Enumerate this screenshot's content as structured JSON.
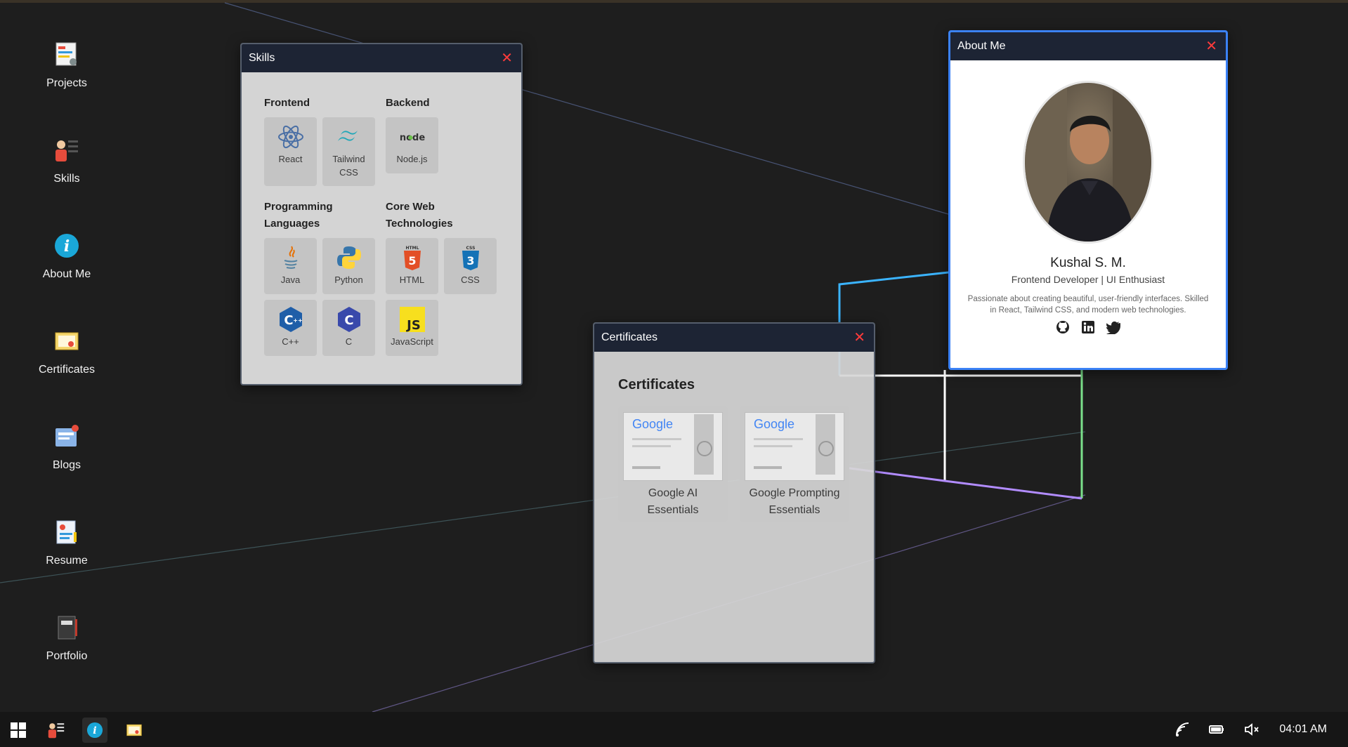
{
  "desktop": {
    "icons": [
      {
        "label": "Projects",
        "icon": "projects-icon"
      },
      {
        "label": "Skills",
        "icon": "skills-icon"
      },
      {
        "label": "About Me",
        "icon": "info-icon"
      },
      {
        "label": "Certificates",
        "icon": "certificate-icon"
      },
      {
        "label": "Blogs",
        "icon": "blog-icon"
      },
      {
        "label": "Resume",
        "icon": "resume-icon"
      },
      {
        "label": "Portfolio",
        "icon": "portfolio-icon"
      }
    ]
  },
  "skills_window": {
    "title": "Skills",
    "close": "✕",
    "groups": {
      "frontend": {
        "title": "Frontend",
        "items": [
          "React",
          "Tailwind CSS"
        ]
      },
      "backend": {
        "title": "Backend",
        "items": [
          "Node.js"
        ]
      },
      "programming": {
        "title": "Programming Languages",
        "items": [
          "Java",
          "Python",
          "C++",
          "C"
        ]
      },
      "core_web": {
        "title": "Core Web Technologies",
        "items": [
          "HTML",
          "CSS",
          "JavaScript"
        ]
      }
    }
  },
  "certificates_window": {
    "title": "Certificates",
    "close": "✕",
    "heading": "Certificates",
    "items": [
      {
        "name": "Google AI Essentials",
        "brand": "Google"
      },
      {
        "name": "Google Prompting Essentials",
        "brand": "Google"
      }
    ]
  },
  "about_window": {
    "title": "About Me",
    "close": "✕",
    "name": "Kushal S. M.",
    "role": "Frontend Developer | UI Enthusiast",
    "description": "Passionate about creating beautiful, user-friendly interfaces. Skilled in React, Tailwind CSS, and modern web technologies.",
    "socials": [
      "github-icon",
      "linkedin-icon",
      "twitter-icon"
    ]
  },
  "taskbar": {
    "items": [
      "windows-start-icon",
      "skills-icon",
      "info-icon",
      "certificate-icon"
    ],
    "active_item": "info-icon",
    "tray": [
      "network-icon",
      "battery-icon",
      "volume-muted-icon"
    ],
    "clock": "04:01 AM"
  },
  "colors": {
    "desktop_bg": "#1e1e1e",
    "titlebar": "#1d2434",
    "close": "#ff3b3b",
    "active_border": "#3b82f6",
    "taskbar": "#161616"
  }
}
